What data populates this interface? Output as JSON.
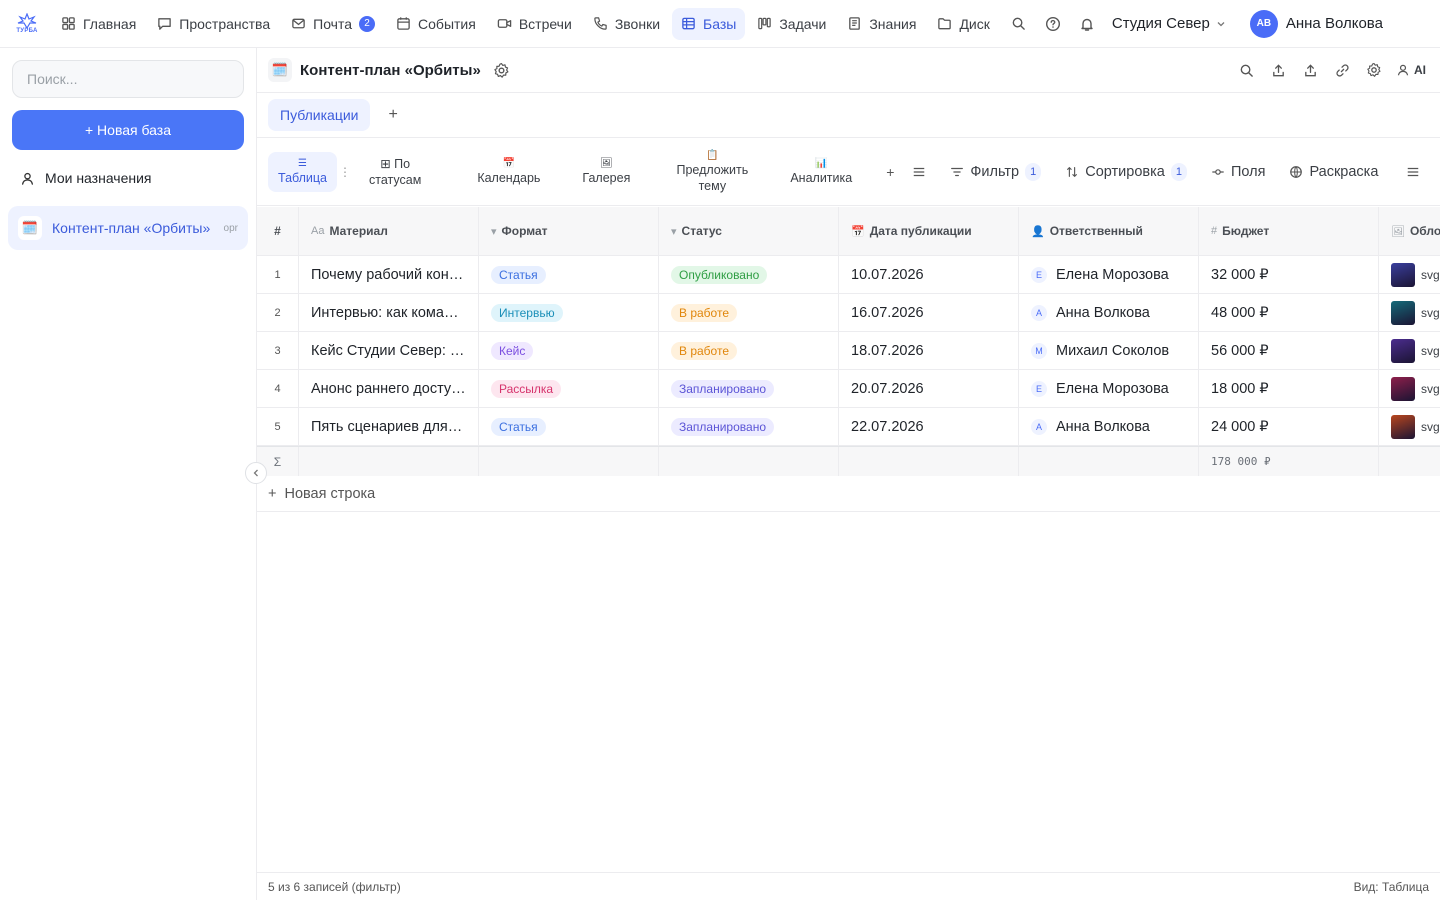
{
  "brand": {
    "logo_text": "ТУРБА",
    "accent": "#4a6cf7"
  },
  "nav": {
    "items": [
      {
        "label": "Главная",
        "icon": "grid-icon"
      },
      {
        "label": "Пространства",
        "icon": "chat-icon"
      },
      {
        "label": "Почта",
        "icon": "mail-icon",
        "badge": "2"
      },
      {
        "label": "События",
        "icon": "calendar-icon"
      },
      {
        "label": "Встречи",
        "icon": "video-icon"
      },
      {
        "label": "Звонки",
        "icon": "phone-icon"
      },
      {
        "label": "Базы",
        "icon": "table-icon",
        "active": true
      },
      {
        "label": "Задачи",
        "icon": "kanban-icon"
      },
      {
        "label": "Знания",
        "icon": "book-icon"
      },
      {
        "label": "Диск",
        "icon": "folder-icon"
      }
    ],
    "workspace": "Студия Север",
    "user_initials": "АВ",
    "user_name": "Анна Волкова"
  },
  "sidebar": {
    "search_placeholder": "Поиск...",
    "new_base": "+ Новая база",
    "my_assignments": "Мои назначения",
    "base": {
      "title": "Контент-план «Орбиты»",
      "tag": "opr",
      "emoji": "🗓️"
    }
  },
  "header": {
    "emoji": "🗓️",
    "title": "Контент-план «Орбиты»",
    "ai_label": "AI"
  },
  "tabs": {
    "items": [
      "Публикации"
    ],
    "add": "+"
  },
  "views": {
    "items": [
      {
        "icon": "☰",
        "label": "Таблица",
        "active": true
      },
      {
        "icon": "⊞ По",
        "label": "статусам"
      },
      {
        "icon": "📅",
        "label": "Календарь"
      },
      {
        "icon": "🖼",
        "label": "Галерея"
      },
      {
        "icon": "📋",
        "label": "Предложить тему"
      },
      {
        "icon": "📊",
        "label": "Аналитика"
      }
    ],
    "add": "+",
    "filter": "Фильтр",
    "filter_count": "1",
    "sort": "Сортировка",
    "sort_count": "1",
    "fields": "Поля",
    "coloring": "Раскраска"
  },
  "table": {
    "columns": {
      "num": "#",
      "material": {
        "icon": "Aa",
        "label": "Материал"
      },
      "format": {
        "icon": "▾",
        "label": "Формат"
      },
      "status": {
        "icon": "▾",
        "label": "Статус"
      },
      "date": {
        "icon": "📅",
        "label": "Дата публикации"
      },
      "responsible": {
        "icon": "👤",
        "label": "Ответственный"
      },
      "budget": {
        "icon": "#",
        "label": "Бюджет"
      },
      "cover": {
        "icon": "🖼",
        "label": "Облож"
      }
    },
    "rows": [
      {
        "n": "1",
        "material": "Почему рабочий контент-план ломается",
        "format": "Статья",
        "format_kind": "blue",
        "status": "Опубликовано",
        "status_kind": "green",
        "date": "10.07.2026",
        "resp_init": "Е",
        "resp": "Елена Морозова",
        "budget": "32 000 ₽",
        "cover_color": "#3a3f9e",
        "cover_text": "svg"
      },
      {
        "n": "2",
        "material": "Интервью: как команда работает",
        "format": "Интервью",
        "format_kind": "cyan",
        "status": "В работе",
        "status_kind": "orange",
        "date": "16.07.2026",
        "resp_init": "А",
        "resp": "Анна Волкова",
        "budget": "48 000 ₽",
        "cover_color": "#156b7a",
        "cover_text": "svg"
      },
      {
        "n": "3",
        "material": "Кейс Студии Север: рост",
        "format": "Кейс",
        "format_kind": "purple",
        "status": "В работе",
        "status_kind": "orange",
        "date": "18.07.2026",
        "resp_init": "М",
        "resp": "Михаил Соколов",
        "budget": "56 000 ₽",
        "cover_color": "#4b2d8f",
        "cover_text": "svg"
      },
      {
        "n": "4",
        "material": "Анонс раннего доступа",
        "format": "Рассылка",
        "format_kind": "pink",
        "status": "Запланировано",
        "status_kind": "violet",
        "date": "20.07.2026",
        "resp_init": "Е",
        "resp": "Елена Морозова",
        "budget": "18 000 ₽",
        "cover_color": "#8e1f4b",
        "cover_text": "svg"
      },
      {
        "n": "5",
        "material": "Пять сценариев для команды",
        "format": "Статья",
        "format_kind": "blue",
        "status": "Запланировано",
        "status_kind": "violet",
        "date": "22.07.2026",
        "resp_init": "А",
        "resp": "Анна Волкова",
        "budget": "24 000 ₽",
        "cover_color": "#b8461e",
        "cover_text": "svg"
      }
    ],
    "sum_symbol": "Σ",
    "budget_total": "178 000 ₽",
    "new_row": "Новая строка"
  },
  "footer": {
    "left": "5 из 6 записей (фильтр)",
    "right": "Вид: Таблица"
  },
  "pill_colors": {
    "blue": {
      "bg": "#e7efff",
      "fg": "#3b6fe0"
    },
    "cyan": {
      "bg": "#dff4fb",
      "fg": "#1b8fb8"
    },
    "purple": {
      "bg": "#efe8ff",
      "fg": "#7b4fe0"
    },
    "pink": {
      "bg": "#fde6ef",
      "fg": "#d6336c"
    },
    "green": {
      "bg": "#e2f7e7",
      "fg": "#2f9e44"
    },
    "orange": {
      "bg": "#fff1dc",
      "fg": "#e0860b"
    },
    "violet": {
      "bg": "#ecebff",
      "fg": "#5b54d6"
    }
  }
}
